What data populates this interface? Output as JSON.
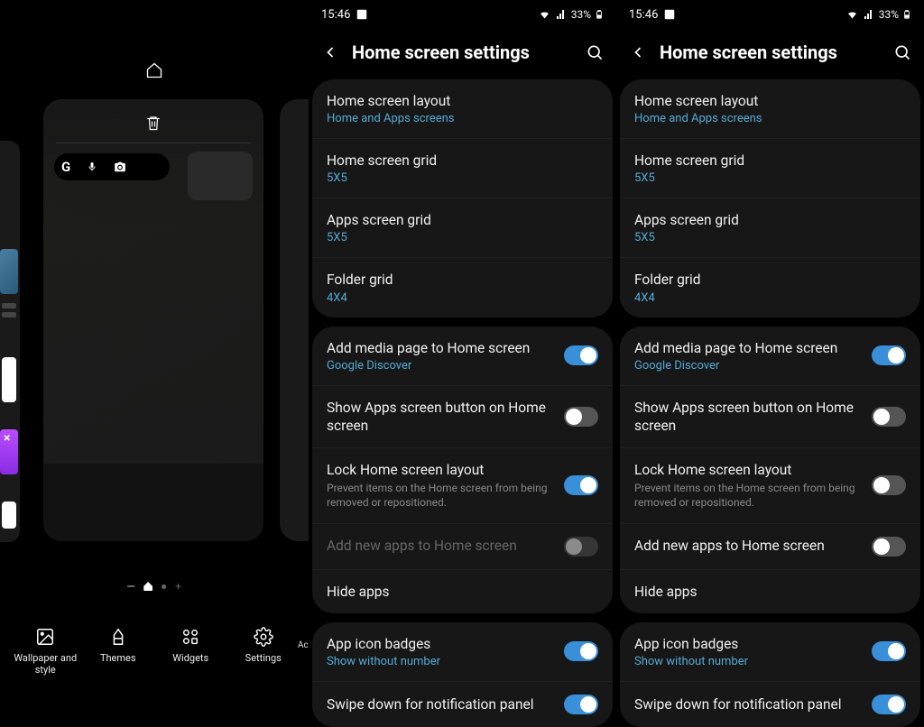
{
  "status": {
    "time": "15:46",
    "battery": "33%"
  },
  "left": {
    "ac": "Ac",
    "bottom": {
      "wallpaper": "Wallpaper and style",
      "themes": "Themes",
      "widgets": "Widgets",
      "settings": "Settings"
    }
  },
  "settings": {
    "title": "Home screen settings",
    "group1": [
      {
        "title": "Home screen layout",
        "sub": "Home and Apps screens"
      },
      {
        "title": "Home screen grid",
        "sub": "5X5"
      },
      {
        "title": "Apps screen grid",
        "sub": "5X5"
      },
      {
        "title": "Folder grid",
        "sub": "4X4"
      }
    ],
    "group2": {
      "media": {
        "title": "Add media page to Home screen",
        "sub": "Google Discover",
        "on": true
      },
      "appsbtn": {
        "title": "Show Apps screen button on Home screen",
        "on": false
      },
      "lock": {
        "title": "Lock Home screen layout",
        "desc": "Prevent items on the Home screen from being removed or repositioned.",
        "on": true
      },
      "addnew_disabled": {
        "title": "Add new apps to Home screen",
        "on": false
      },
      "hide": {
        "title": "Hide apps"
      }
    },
    "group2_right": {
      "lock_on": false,
      "addnew_on": false
    },
    "group3": {
      "badges": {
        "title": "App icon badges",
        "sub": "Show without number",
        "on": true
      },
      "swipe": {
        "title": "Swipe down for notification panel",
        "on": true
      }
    }
  }
}
